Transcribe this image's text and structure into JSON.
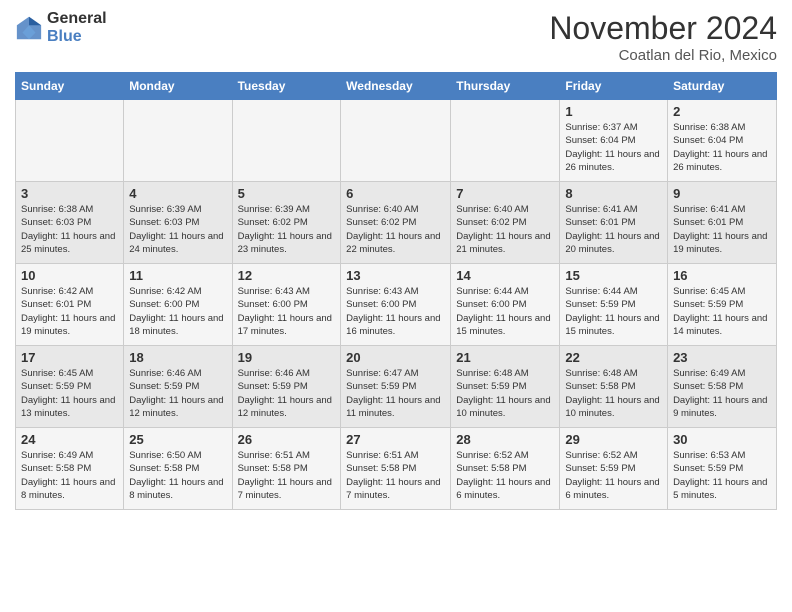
{
  "logo": {
    "general": "General",
    "blue": "Blue"
  },
  "header": {
    "month": "November 2024",
    "location": "Coatlan del Rio, Mexico"
  },
  "days_of_week": [
    "Sunday",
    "Monday",
    "Tuesday",
    "Wednesday",
    "Thursday",
    "Friday",
    "Saturday"
  ],
  "weeks": [
    [
      {
        "day": "",
        "info": ""
      },
      {
        "day": "",
        "info": ""
      },
      {
        "day": "",
        "info": ""
      },
      {
        "day": "",
        "info": ""
      },
      {
        "day": "",
        "info": ""
      },
      {
        "day": "1",
        "info": "Sunrise: 6:37 AM\nSunset: 6:04 PM\nDaylight: 11 hours and 26 minutes."
      },
      {
        "day": "2",
        "info": "Sunrise: 6:38 AM\nSunset: 6:04 PM\nDaylight: 11 hours and 26 minutes."
      }
    ],
    [
      {
        "day": "3",
        "info": "Sunrise: 6:38 AM\nSunset: 6:03 PM\nDaylight: 11 hours and 25 minutes."
      },
      {
        "day": "4",
        "info": "Sunrise: 6:39 AM\nSunset: 6:03 PM\nDaylight: 11 hours and 24 minutes."
      },
      {
        "day": "5",
        "info": "Sunrise: 6:39 AM\nSunset: 6:02 PM\nDaylight: 11 hours and 23 minutes."
      },
      {
        "day": "6",
        "info": "Sunrise: 6:40 AM\nSunset: 6:02 PM\nDaylight: 11 hours and 22 minutes."
      },
      {
        "day": "7",
        "info": "Sunrise: 6:40 AM\nSunset: 6:02 PM\nDaylight: 11 hours and 21 minutes."
      },
      {
        "day": "8",
        "info": "Sunrise: 6:41 AM\nSunset: 6:01 PM\nDaylight: 11 hours and 20 minutes."
      },
      {
        "day": "9",
        "info": "Sunrise: 6:41 AM\nSunset: 6:01 PM\nDaylight: 11 hours and 19 minutes."
      }
    ],
    [
      {
        "day": "10",
        "info": "Sunrise: 6:42 AM\nSunset: 6:01 PM\nDaylight: 11 hours and 19 minutes."
      },
      {
        "day": "11",
        "info": "Sunrise: 6:42 AM\nSunset: 6:00 PM\nDaylight: 11 hours and 18 minutes."
      },
      {
        "day": "12",
        "info": "Sunrise: 6:43 AM\nSunset: 6:00 PM\nDaylight: 11 hours and 17 minutes."
      },
      {
        "day": "13",
        "info": "Sunrise: 6:43 AM\nSunset: 6:00 PM\nDaylight: 11 hours and 16 minutes."
      },
      {
        "day": "14",
        "info": "Sunrise: 6:44 AM\nSunset: 6:00 PM\nDaylight: 11 hours and 15 minutes."
      },
      {
        "day": "15",
        "info": "Sunrise: 6:44 AM\nSunset: 5:59 PM\nDaylight: 11 hours and 15 minutes."
      },
      {
        "day": "16",
        "info": "Sunrise: 6:45 AM\nSunset: 5:59 PM\nDaylight: 11 hours and 14 minutes."
      }
    ],
    [
      {
        "day": "17",
        "info": "Sunrise: 6:45 AM\nSunset: 5:59 PM\nDaylight: 11 hours and 13 minutes."
      },
      {
        "day": "18",
        "info": "Sunrise: 6:46 AM\nSunset: 5:59 PM\nDaylight: 11 hours and 12 minutes."
      },
      {
        "day": "19",
        "info": "Sunrise: 6:46 AM\nSunset: 5:59 PM\nDaylight: 11 hours and 12 minutes."
      },
      {
        "day": "20",
        "info": "Sunrise: 6:47 AM\nSunset: 5:59 PM\nDaylight: 11 hours and 11 minutes."
      },
      {
        "day": "21",
        "info": "Sunrise: 6:48 AM\nSunset: 5:59 PM\nDaylight: 11 hours and 10 minutes."
      },
      {
        "day": "22",
        "info": "Sunrise: 6:48 AM\nSunset: 5:58 PM\nDaylight: 11 hours and 10 minutes."
      },
      {
        "day": "23",
        "info": "Sunrise: 6:49 AM\nSunset: 5:58 PM\nDaylight: 11 hours and 9 minutes."
      }
    ],
    [
      {
        "day": "24",
        "info": "Sunrise: 6:49 AM\nSunset: 5:58 PM\nDaylight: 11 hours and 8 minutes."
      },
      {
        "day": "25",
        "info": "Sunrise: 6:50 AM\nSunset: 5:58 PM\nDaylight: 11 hours and 8 minutes."
      },
      {
        "day": "26",
        "info": "Sunrise: 6:51 AM\nSunset: 5:58 PM\nDaylight: 11 hours and 7 minutes."
      },
      {
        "day": "27",
        "info": "Sunrise: 6:51 AM\nSunset: 5:58 PM\nDaylight: 11 hours and 7 minutes."
      },
      {
        "day": "28",
        "info": "Sunrise: 6:52 AM\nSunset: 5:58 PM\nDaylight: 11 hours and 6 minutes."
      },
      {
        "day": "29",
        "info": "Sunrise: 6:52 AM\nSunset: 5:59 PM\nDaylight: 11 hours and 6 minutes."
      },
      {
        "day": "30",
        "info": "Sunrise: 6:53 AM\nSunset: 5:59 PM\nDaylight: 11 hours and 5 minutes."
      }
    ]
  ]
}
